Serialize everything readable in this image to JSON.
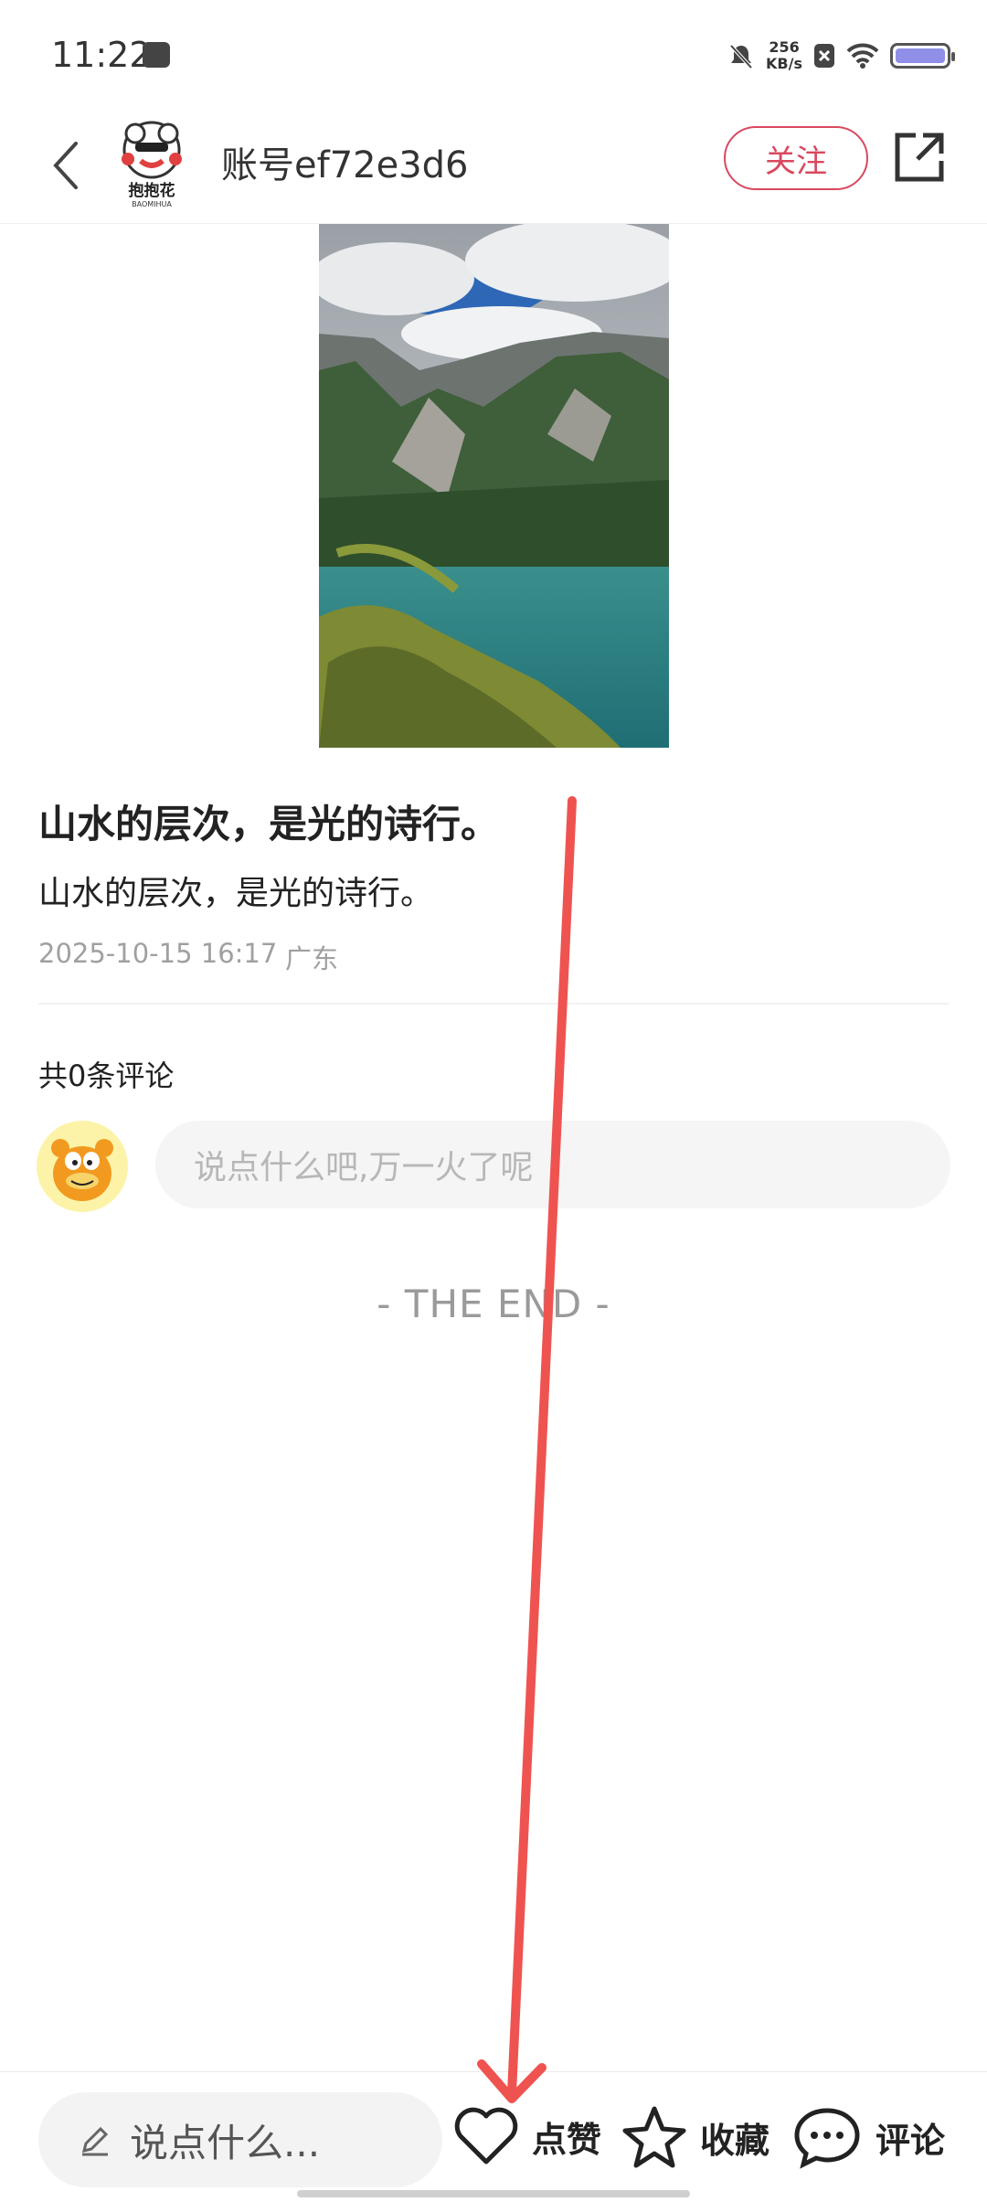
{
  "status_bar": {
    "time": "11:22",
    "net_speed_value": "256",
    "net_speed_unit": "KB/s"
  },
  "header": {
    "account_name": "账号ef72e3d6",
    "follow_label": "关注",
    "logo_text": "抱抱花",
    "logo_subtext": "BAOMIHUA"
  },
  "post": {
    "title": "山水的层次，是光的诗行。",
    "body": "山水的层次，是光的诗行。",
    "date": "2025-10-15 16:17",
    "location": "广东"
  },
  "comments": {
    "count_label": "共0条评论",
    "input_placeholder": "说点什么吧,万一火了呢"
  },
  "end_label": "- THE END -",
  "bottom_bar": {
    "input_placeholder": "说点什么...",
    "like_label": "点赞",
    "favorite_label": "收藏",
    "comment_label": "评论"
  },
  "colors": {
    "accent": "#d9485f",
    "annotation_arrow": "#ef5350"
  },
  "icons": {
    "back": "chevron-left-icon",
    "share": "share-icon",
    "pencil": "pencil-icon",
    "like": "heart-icon",
    "favorite": "star-icon",
    "comment": "chat-bubble-icon"
  }
}
